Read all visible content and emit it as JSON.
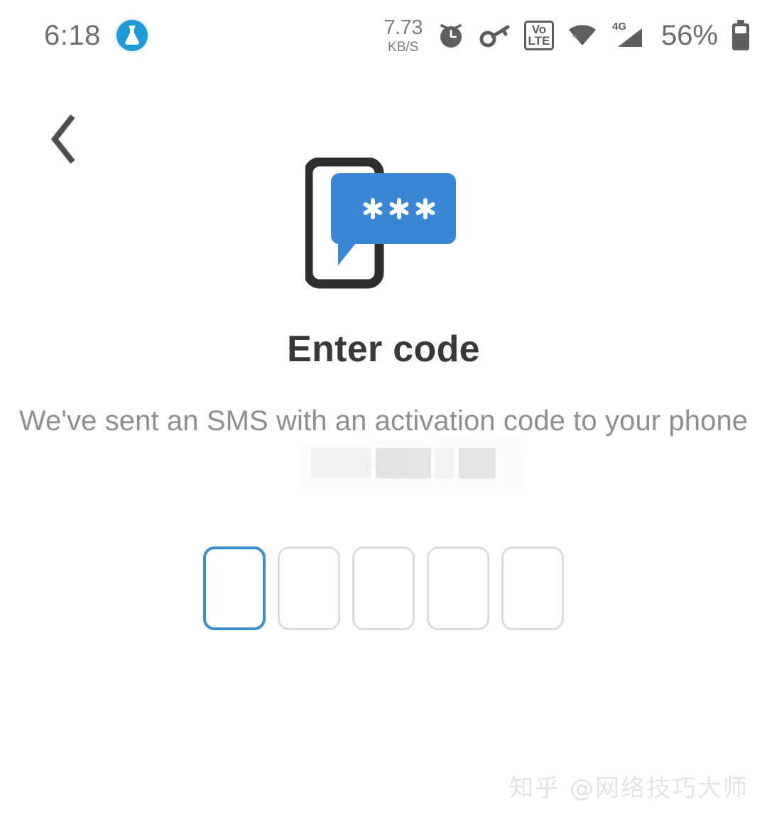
{
  "statusbar": {
    "time": "6:18",
    "notification_icon": "flask-icon",
    "network_speed_value": "7.73",
    "network_speed_unit": "KB/S",
    "alarm_icon": "alarm-clock-icon",
    "vpn_icon": "key-icon",
    "volte_top": "Vo",
    "volte_bottom": "LTE",
    "wifi_icon": "wifi-icon",
    "signal_label": "4G",
    "signal_icon": "cellular-signal-icon",
    "battery_percent": "56%",
    "battery_icon": "battery-icon"
  },
  "nav": {
    "back_icon": "chevron-left-icon",
    "back_label": "Back"
  },
  "illustration": {
    "name": "sms-code-illustration",
    "phone_color": "#2e2e2e",
    "bubble_color": "#3b86d4",
    "masked_digits": "***"
  },
  "content": {
    "title": "Enter code",
    "description": "We've sent an SMS with an activation code to your phone",
    "phone_prefix": "+86",
    "phone_redacted": true
  },
  "code_input": {
    "length": 5,
    "focused_index": 0,
    "values": [
      "",
      "",
      "",
      "",
      ""
    ],
    "focus_color": "#3e8fc8",
    "idle_color": "#dcdcdc"
  },
  "watermark": {
    "text": "知乎 @网络技巧大师"
  }
}
